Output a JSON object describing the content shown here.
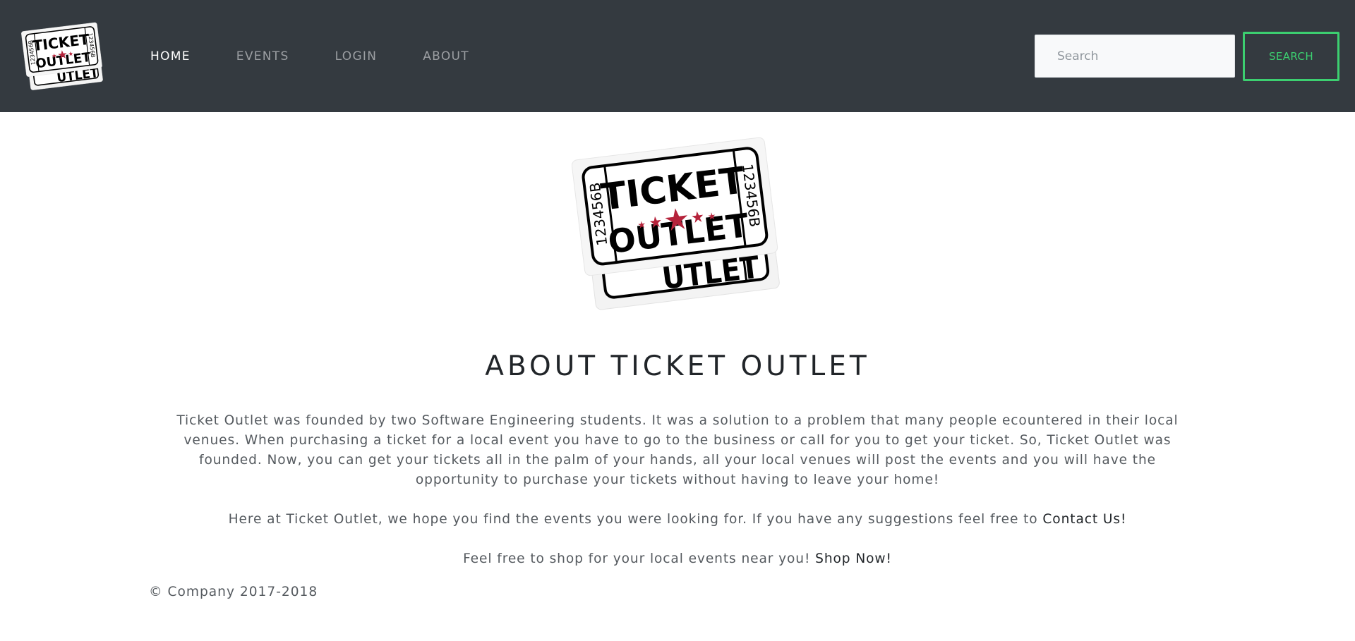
{
  "brand": {
    "logo_line1": "TICKET",
    "logo_line2": "OUTLET",
    "serial": "123456B",
    "ghost_text": "UTLET"
  },
  "nav": {
    "items": [
      {
        "label": "HOME",
        "active": true
      },
      {
        "label": "EVENTS",
        "active": false
      },
      {
        "label": "LOGIN",
        "active": false
      },
      {
        "label": "ABOUT",
        "active": false
      }
    ]
  },
  "search": {
    "placeholder": "Search",
    "value": "",
    "button_label": "SEARCH"
  },
  "about": {
    "heading": "ABOUT TICKET OUTLET",
    "paragraph1": "Ticket Outlet was founded by two Software Engineering students. It was a solution to a problem that many people ecountered in their local venues. When purchasing a ticket for a local event you have to go to the business or call for you to get your ticket. So, Ticket Outlet was founded. Now, you can get your tickets all in the palm of your hands, all your local venues will post the events and you will have the opportunity to purchase your tickets without having to leave your home!",
    "paragraph2_text": "Here at Ticket Outlet, we hope you find the events you were looking for. If you have any suggestions feel free to ",
    "paragraph2_link": "Contact Us!",
    "paragraph3_text": "Feel free to shop for your local events near you! ",
    "paragraph3_link": "Shop Now!"
  },
  "footer": {
    "copyright": "© Company 2017-2018"
  },
  "colors": {
    "navbar_bg": "#343a40",
    "accent_green": "#3ccf70",
    "star_red": "#b5233b"
  }
}
